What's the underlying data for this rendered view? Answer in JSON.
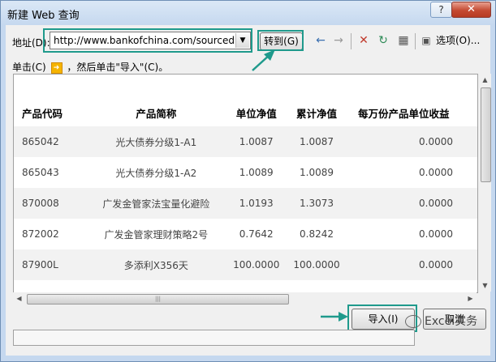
{
  "window": {
    "title": "新建 Web 查询",
    "help_glyph": "?",
    "close_glyph": "✕"
  },
  "toolbar": {
    "address_label": "地址(D):",
    "address_value": "http://www.bankofchina.com/sourcedb",
    "go_label": "转到(G)",
    "options_label": "选项(O)..."
  },
  "instruction": {
    "prefix": "单击(C)",
    "suffix": "，然后单击\"导入\"(C)。"
  },
  "table": {
    "headers": [
      "产品代码",
      "产品简称",
      "单位净值",
      "累计净值",
      "每万份产品单位收益"
    ],
    "rows": [
      [
        "865042",
        "光大债券分级1-A1",
        "1.0087",
        "1.0087",
        "0.0000"
      ],
      [
        "865043",
        "光大债券分级1-A2",
        "1.0089",
        "1.0089",
        "0.0000"
      ],
      [
        "870008",
        "广发金管家法宝量化避险",
        "1.0193",
        "1.3073",
        "0.0000"
      ],
      [
        "872002",
        "广发金管家理财策略2号",
        "0.7642",
        "0.8242",
        "0.0000"
      ],
      [
        "87900L",
        "多添利X356天",
        "100.0000",
        "100.0000",
        "0.0000"
      ]
    ]
  },
  "buttons": {
    "import_label": "导入(I)",
    "cancel_label": "取消"
  },
  "watermark": "Excel实务",
  "colors": {
    "highlight": "#1f9a8c",
    "close": "#c44a32"
  }
}
